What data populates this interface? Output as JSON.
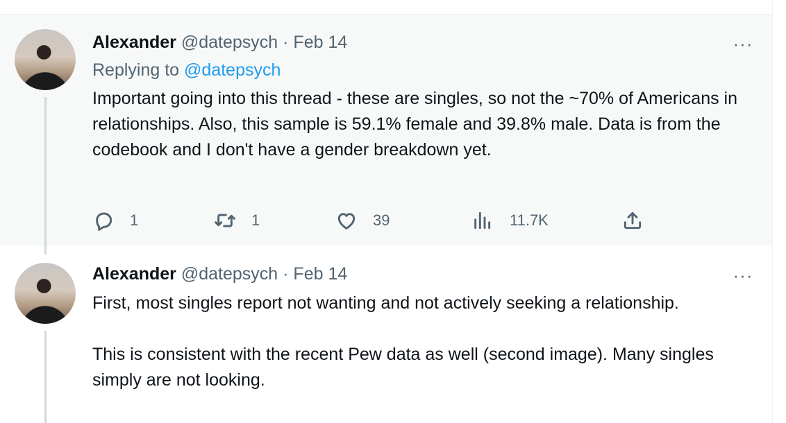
{
  "tweets": [
    {
      "name": "Alexander",
      "handle": "@datepsych",
      "separator": "·",
      "date": "Feb 14",
      "replying_prefix": "Replying to",
      "replying_to": "@datepsych",
      "text": "Important going into this thread - these are singles, so not the ~70% of Americans in relationships. Also, this sample is 59.1% female and 39.8% male. Data is from the codebook and I don't have a gender breakdown yet.",
      "more": "···",
      "actions": {
        "replies": "1",
        "retweets": "1",
        "likes": "39",
        "views": "11.7K"
      }
    },
    {
      "name": "Alexander",
      "handle": "@datepsych",
      "separator": "·",
      "date": "Feb 14",
      "text": "First, most singles report not wanting and not actively seeking a relationship.\n\nThis is consistent with the recent Pew data as well (second image). Many singles simply are not looking.",
      "more": "···"
    }
  ],
  "icons": [
    "reply-icon",
    "retweet-icon",
    "like-icon",
    "views-icon",
    "share-icon",
    "more-icon"
  ],
  "colors": {
    "mention": "#1d9bf0",
    "secondary_text": "#536471",
    "thread_line": "#cfd9de",
    "highlight_bg": "#f7f9f9"
  }
}
